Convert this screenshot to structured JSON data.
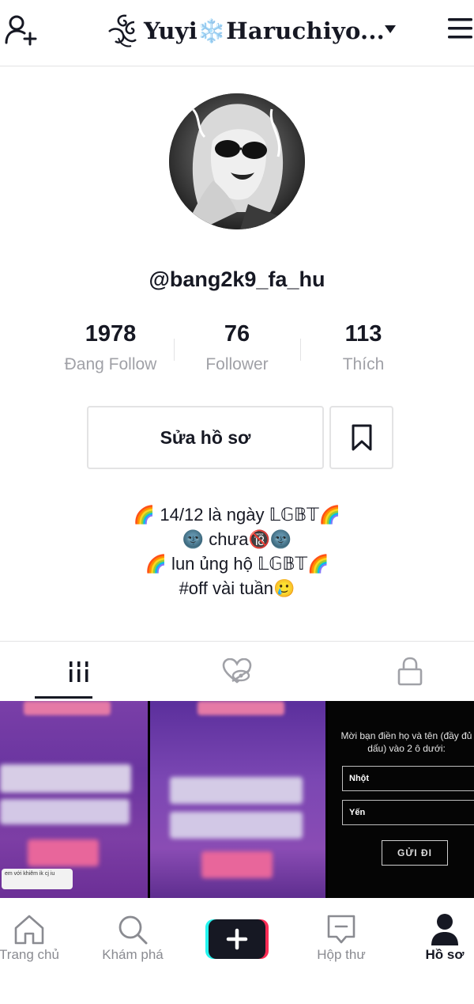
{
  "header": {
    "display_name": "Yuyi❄️Haruchiyo...",
    "add_friend_icon": "person-add-icon",
    "dropdown_icon": "chevron-down-icon",
    "menu_icon": "hamburger-menu-icon"
  },
  "profile": {
    "username": "@bang2k9_fa_hu",
    "stats": [
      {
        "value": "1978",
        "label": "Đang Follow"
      },
      {
        "value": "76",
        "label": "Follower"
      },
      {
        "value": "113",
        "label": "Thích"
      }
    ],
    "edit_button": "Sửa hồ sơ",
    "bookmark_icon": "bookmark-icon",
    "bio": [
      "🌈 14/12 là ngày 𝕃𝔾𝔹𝕋🌈",
      "🌚 chưa🔞🌚",
      "🌈 lun ủng hộ 𝕃𝔾𝔹𝕋🌈",
      "#off vài tuần🥲"
    ]
  },
  "tabs": {
    "videos_icon": "grid-icon",
    "liked_icon": "hidden-heart-icon",
    "private_icon": "lock-icon"
  },
  "videos": {
    "thumb1_caption": "em với khiêm ik cj iu",
    "thumb3_prompt": "Mời bạn điền họ và tên (đầy đủ dấu) vào 2 ô dưới:",
    "thumb3_field1": "Nhột",
    "thumb3_field2": "Yến",
    "thumb3_button": "GỬI ĐI"
  },
  "bottom_nav": [
    {
      "label": "Trang chủ",
      "icon": "home-icon"
    },
    {
      "label": "Khám phá",
      "icon": "search-icon"
    },
    {
      "label": "",
      "icon": "plus-icon"
    },
    {
      "label": "Hộp thư",
      "icon": "inbox-icon"
    },
    {
      "label": "Hồ sơ",
      "icon": "profile-icon"
    }
  ],
  "colors": {
    "text": "#161823",
    "muted": "#a0a1a7",
    "border": "#e3e3e4",
    "tiktok_cyan": "#25f4ee",
    "tiktok_red": "#fe2c55"
  }
}
